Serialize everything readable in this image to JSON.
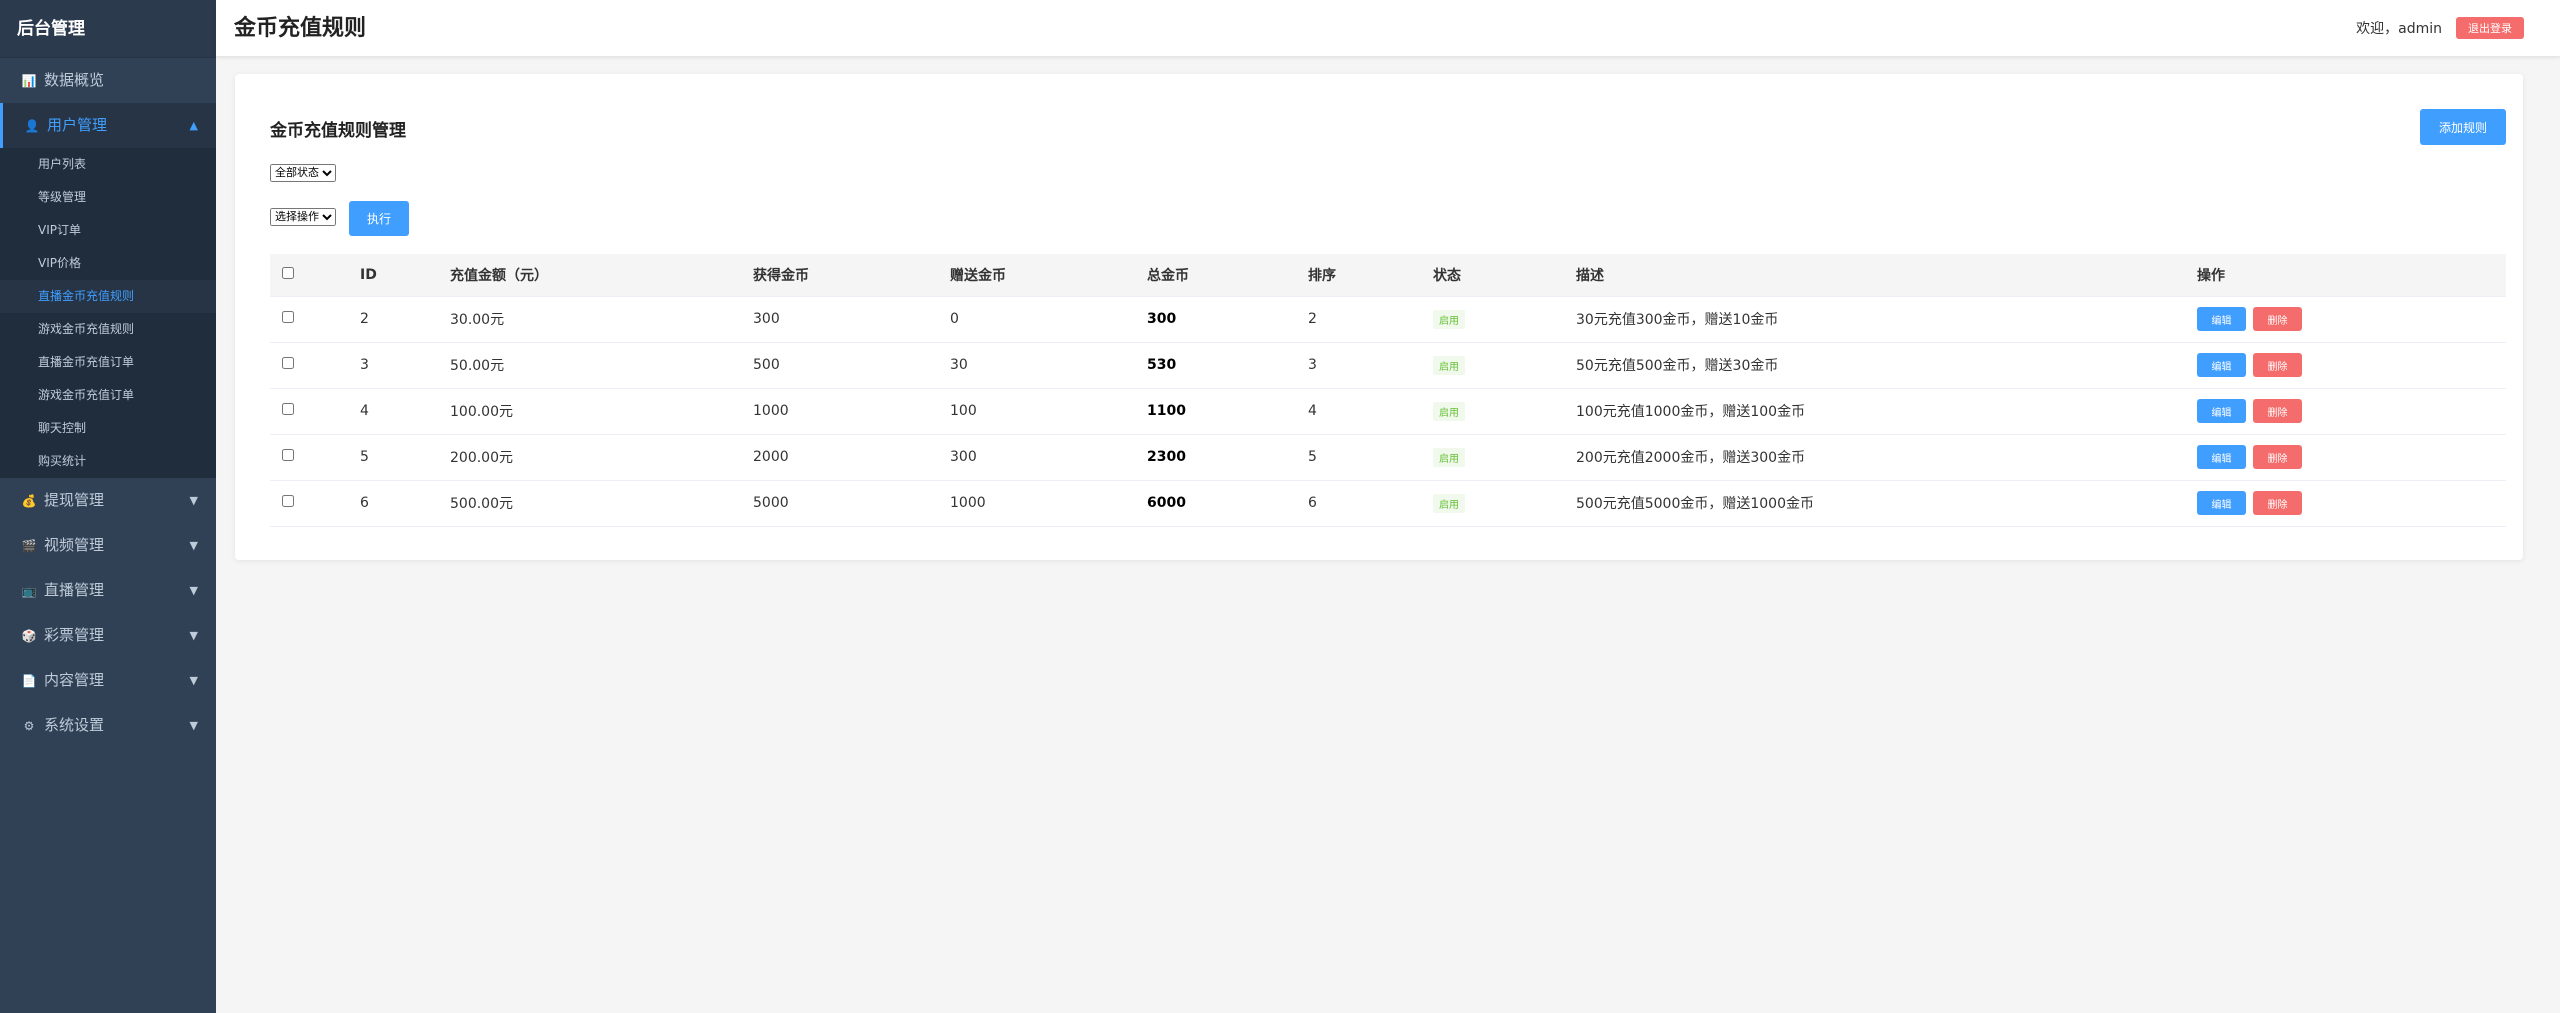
{
  "app": {
    "brand": "后台管理"
  },
  "sidebar": {
    "menus": [
      {
        "icon": "📊",
        "label": "数据概览",
        "arrow": ""
      },
      {
        "icon": "👤",
        "label": "用户管理",
        "arrow": "▲",
        "open": true
      },
      {
        "icon": "💰",
        "label": "提现管理",
        "arrow": "▼"
      },
      {
        "icon": "🎬",
        "label": "视频管理",
        "arrow": "▼"
      },
      {
        "icon": "📺",
        "label": "直播管理",
        "arrow": "▼"
      },
      {
        "icon": "🎲",
        "label": "彩票管理",
        "arrow": "▼"
      },
      {
        "icon": "📄",
        "label": "内容管理",
        "arrow": "▼"
      },
      {
        "icon": "⚙",
        "label": "系统设置",
        "arrow": "▼"
      }
    ],
    "submenu": [
      {
        "label": "用户列表"
      },
      {
        "label": "等级管理"
      },
      {
        "label": "VIP订单"
      },
      {
        "label": "VIP价格"
      },
      {
        "label": "直播金币充值规则",
        "active": true
      },
      {
        "label": "游戏金币充值规则"
      },
      {
        "label": "直播金币充值订单"
      },
      {
        "label": "游戏金币充值订单"
      },
      {
        "label": "聊天控制"
      },
      {
        "label": "购买统计"
      }
    ]
  },
  "header": {
    "title": "金币充值规则",
    "welcome": "欢迎，admin",
    "logout_label": "退出登录"
  },
  "card": {
    "title": "金币充值规则管理",
    "add_label": "添加规则",
    "status_filter": "全部状态",
    "op_select": "选择操作",
    "exec_label": "执行"
  },
  "table": {
    "headers": [
      "ID",
      "充值金额（元）",
      "获得金币",
      "赠送金币",
      "总金币",
      "排序",
      "状态",
      "描述",
      "操作"
    ],
    "rows": [
      {
        "id": "2",
        "amount": "30.00元",
        "coins": "300",
        "bonus": "0",
        "total": "300",
        "sort": "2",
        "status": "启用",
        "desc": "30元充值300金币，赠送10金币"
      },
      {
        "id": "3",
        "amount": "50.00元",
        "coins": "500",
        "bonus": "30",
        "total": "530",
        "sort": "3",
        "status": "启用",
        "desc": "50元充值500金币，赠送30金币"
      },
      {
        "id": "4",
        "amount": "100.00元",
        "coins": "1000",
        "bonus": "100",
        "total": "1100",
        "sort": "4",
        "status": "启用",
        "desc": "100元充值1000金币，赠送100金币"
      },
      {
        "id": "5",
        "amount": "200.00元",
        "coins": "2000",
        "bonus": "300",
        "total": "2300",
        "sort": "5",
        "status": "启用",
        "desc": "200元充值2000金币，赠送300金币"
      },
      {
        "id": "6",
        "amount": "500.00元",
        "coins": "5000",
        "bonus": "1000",
        "total": "6000",
        "sort": "6",
        "status": "启用",
        "desc": "500元充值5000金币，赠送1000金币"
      }
    ],
    "edit_label": "编辑",
    "delete_label": "删除"
  },
  "colors": {
    "sidebar": "#304156",
    "accent": "#409eff",
    "danger": "#f56c6c",
    "success": "#67c23a"
  }
}
